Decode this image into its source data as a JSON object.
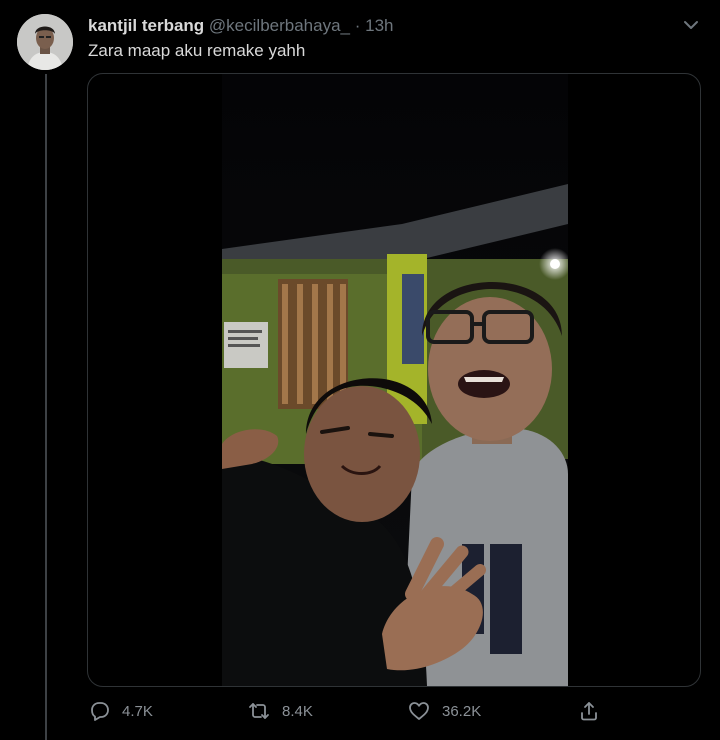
{
  "tweet": {
    "author_name": "kantjil terbang",
    "author_handle": "@kecilberbahaya_",
    "separator": "·",
    "time": "13h",
    "text": "Zara maap aku remake yahh"
  },
  "media": {
    "type": "video",
    "description_icon": "video-thumbnail"
  },
  "actions": {
    "reply_count": "4.7K",
    "retweet_count": "8.4K",
    "like_count": "36.2K",
    "reply_icon": "speech-bubble",
    "retweet_icon": "retweet-arrows",
    "like_icon": "heart",
    "share_icon": "share-upload"
  },
  "colors": {
    "background": "#000000",
    "primary_text": "#d9d9d9",
    "secondary_text": "#6e767d",
    "border": "#2f3336"
  }
}
